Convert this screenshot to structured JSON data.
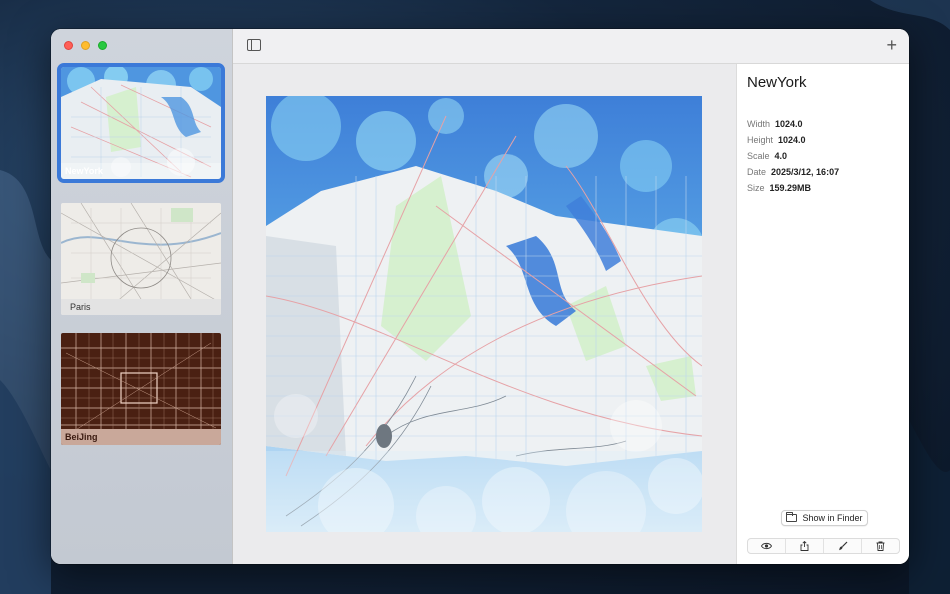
{
  "app": {
    "window_controls": [
      "close",
      "minimize",
      "zoom"
    ]
  },
  "sidebar": {
    "items": [
      {
        "label": "NewYork",
        "selected": true,
        "theme": "blue-bokeh"
      },
      {
        "label": "Paris",
        "selected": false,
        "theme": "light-gray"
      },
      {
        "label": "BeiJing",
        "selected": false,
        "theme": "dark-brown"
      }
    ]
  },
  "toolbar": {
    "sidebar_toggle_icon": "sidebar-toggle-icon",
    "add_icon": "plus-icon",
    "add_label": "+"
  },
  "inspector": {
    "title": "NewYork",
    "width_label": "Width",
    "width_value": "1024.0",
    "height_label": "Height",
    "height_value": "1024.0",
    "scale_label": "Scale",
    "scale_value": "4.0",
    "date_label": "Date",
    "date_value": "2025/3/12, 16:07",
    "size_label": "Size",
    "size_value": "159.29MB",
    "show_in_finder_label": "Show in Finder",
    "actions": [
      "eye-icon",
      "share-icon",
      "brush-icon",
      "trash-icon"
    ]
  },
  "colors": {
    "accent": "#3b79d8",
    "map_blue": "#3f7fd9",
    "map_park": "#d6f0cf",
    "beijing_bg": "#4a2012"
  }
}
